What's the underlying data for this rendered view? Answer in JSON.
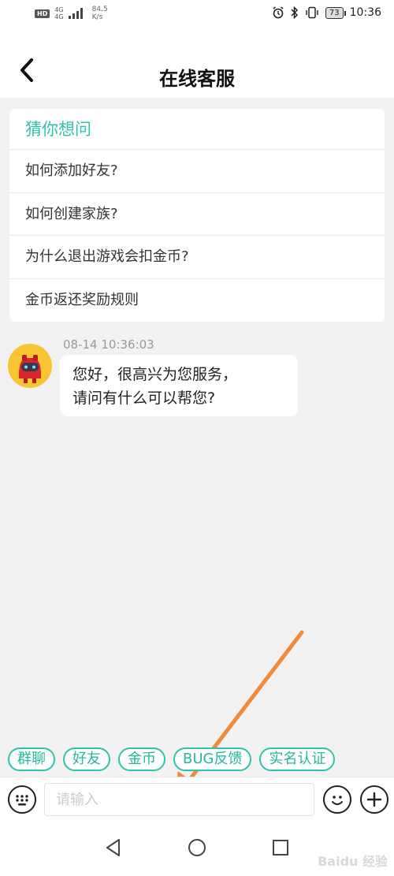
{
  "status_bar": {
    "hd_badge": "HD",
    "network_top": "4G",
    "network_bottom": "4G",
    "speed_value": "84.5",
    "speed_unit": "K/s",
    "battery": "73",
    "time": "10:36"
  },
  "header": {
    "title": "在线客服"
  },
  "faq": {
    "title": "猜你想问",
    "items": [
      "如何添加好友?",
      "如何创建家族?",
      "为什么退出游戏会扣金币?",
      "金币返还奖励规则"
    ]
  },
  "message": {
    "timestamp": "08-14 10:36:03",
    "line1": "您好，很高兴为您服务，",
    "line2": "请问有什么可以帮您?"
  },
  "quick_tags": [
    "群聊",
    "好友",
    "金币",
    "BUG反馈",
    "实名认证"
  ],
  "input": {
    "placeholder": "请输入",
    "value": ""
  },
  "icons": {
    "back": "back-icon",
    "keyboard": "keyboard-icon",
    "emoji": "emoji-icon",
    "plus": "plus-icon",
    "nav_back": "nav-back-icon",
    "nav_home": "nav-home-icon",
    "nav_recent": "nav-recent-icon"
  },
  "colors": {
    "accent": "#2ec4a8",
    "annotation_arrow": "#f28a3c",
    "avatar_bg": "#f7c531"
  },
  "watermark": "Baidu 经验"
}
